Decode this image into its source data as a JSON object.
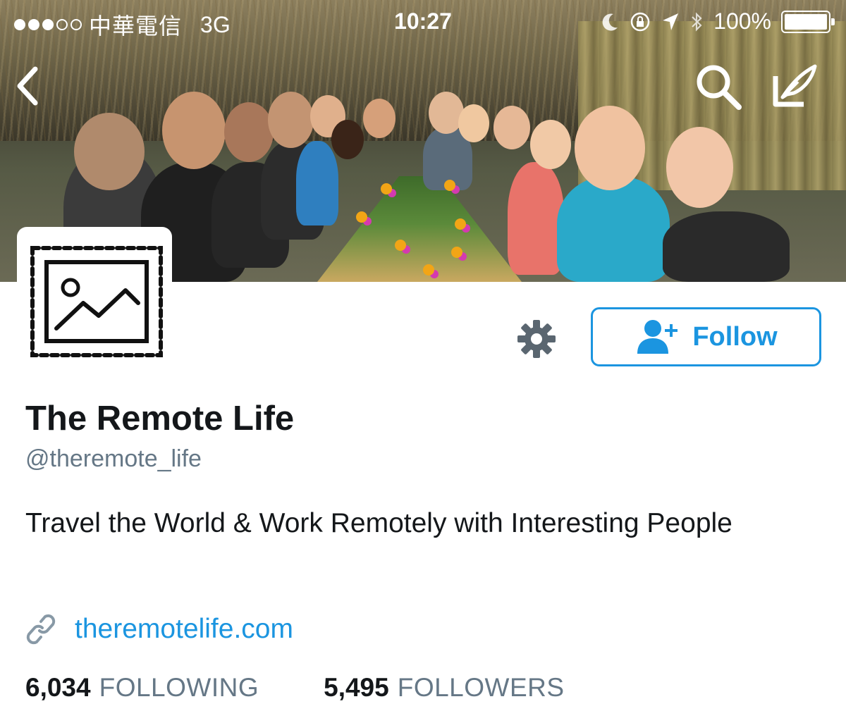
{
  "status_bar": {
    "signal_dots": [
      true,
      true,
      true,
      false,
      false
    ],
    "carrier": "中華電信",
    "network": "3G",
    "time": "10:27",
    "battery_percent": "100%",
    "battery_level": 1.0
  },
  "header": {
    "back_icon": "chevron-left-icon",
    "search_icon": "search-icon",
    "compose_icon": "compose-quill-icon"
  },
  "profile": {
    "avatar_icon": "image-placeholder-icon",
    "name": "The Remote Life",
    "handle": "@theremote_life",
    "bio": "Travel the World & Work Remotely with Interesting People",
    "url_icon": "link-icon",
    "url": "theremotelife.com"
  },
  "actions": {
    "settings_icon": "gear-icon",
    "follow_icon": "add-user-icon",
    "follow_label": "Follow"
  },
  "stats": {
    "following_count": "6,034",
    "following_label": "FOLLOWING",
    "followers_count": "5,495",
    "followers_label": "FOLLOWERS"
  },
  "colors": {
    "accent": "#1b95e0",
    "secondary_text": "#657786",
    "primary_text": "#14171a"
  }
}
